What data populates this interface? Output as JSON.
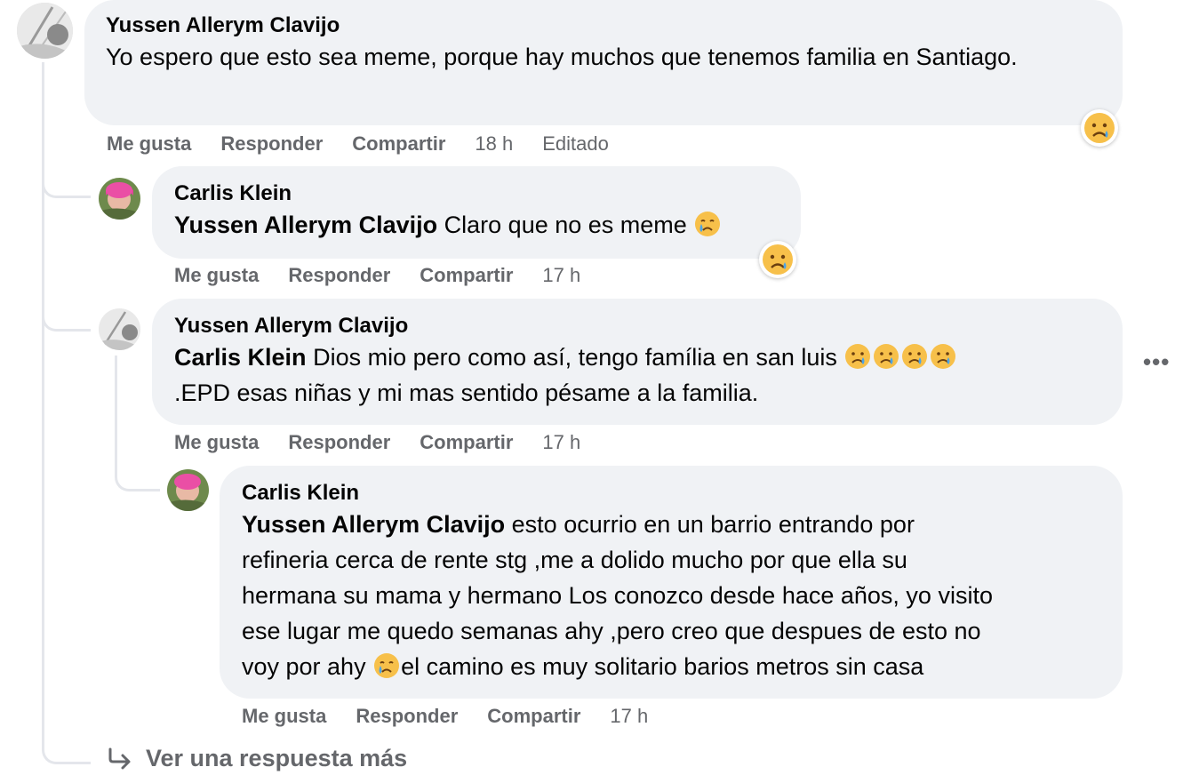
{
  "comments": [
    {
      "author": "Yussen Allerym Clavijo",
      "text": "Yo espero que esto sea meme, porque hay muchos que tenemos familia en Santiago.",
      "actions": {
        "like": "Me gusta",
        "reply": "Responder",
        "share": "Compartir",
        "time": "18 h",
        "edited": "Editado"
      },
      "reaction": "sad-reaction-icon"
    },
    {
      "author": "Carlis Klein",
      "mention": "Yussen Allerym Clavijo",
      "text": "Claro que no es meme",
      "actions": {
        "like": "Me gusta",
        "reply": "Responder",
        "share": "Compartir",
        "time": "17 h"
      },
      "reaction": "sad-reaction-icon"
    },
    {
      "author": "Yussen Allerym Clavijo",
      "mention": "Carlis Klein",
      "text_line1": "Dios mio pero como así, tengo família en san luis",
      "text_line2": ".EPD esas niñas y mi mas sentido pésame a la familia.",
      "actions": {
        "like": "Me gusta",
        "reply": "Responder",
        "share": "Compartir",
        "time": "17 h"
      }
    },
    {
      "author": "Carlis Klein",
      "mention": "Yussen Allerym Clavijo",
      "text_line1": "esto ocurrio en un barrio entrando por",
      "text_line2": "refineria cerca de rente stg ,me a dolido mucho por que ella su",
      "text_line3": "hermana su mama y hermano Los conozco desde hace años, yo visito",
      "text_line4": "ese lugar me quedo semanas ahy ,pero creo que despues de esto no",
      "text_line5a": "voy por ahy",
      "text_line5b": "el camino es muy solitario barios metros sin casa",
      "actions": {
        "like": "Me gusta",
        "reply": "Responder",
        "share": "Compartir",
        "time": "17 h"
      }
    }
  ],
  "more_options": "•••",
  "view_more_reply": "Ver una respuesta más",
  "colors": {
    "bubble": "#f0f2f5",
    "secondary_text": "#65676b",
    "thread_line": "#e4e6eb"
  }
}
